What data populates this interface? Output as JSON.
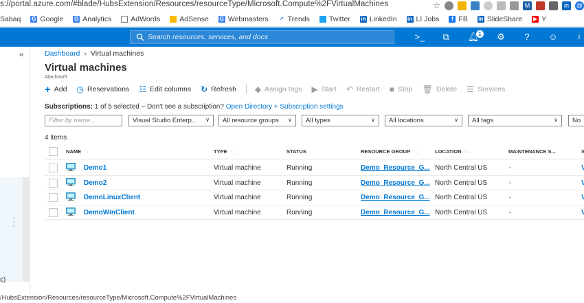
{
  "browser": {
    "url": "s://portal.azure.com/#blade/HubsExtension/Resources/resourceType/Microsoft.Compute%2FVirtualMachines",
    "bookmarks": [
      "Sabaq",
      "Google",
      "Analytics",
      "AdWords",
      "AdSense",
      "Webmasters",
      "Trends",
      "Twitter",
      "LinkedIn",
      "LI Jobs",
      "FB",
      "SlideShare",
      "Y"
    ],
    "status_url": "/HubsExtension/Resources/resourceType/Microsoft.Compute%2FVirtualMachines"
  },
  "topbar": {
    "search_placeholder": "Search resources, services, and docs",
    "notification_count": "1",
    "user_initial": "i"
  },
  "leftnav": {
    "collapse_label": "«",
    "fragment": "c)"
  },
  "breadcrumb": {
    "home": "Dashboard",
    "current": "Virtual machines"
  },
  "page": {
    "title": "Virtual machines",
    "subtitle": "Alachisoft"
  },
  "commands": {
    "add": "Add",
    "reservations": "Reservations",
    "edit_columns": "Edit columns",
    "refresh": "Refresh",
    "assign_tags": "Assign tags",
    "start": "Start",
    "restart": "Restart",
    "stop": "Stop",
    "delete": "Delete",
    "services": "Services"
  },
  "subscriptions": {
    "label": "Subscriptions:",
    "text": " 1 of 5 selected – Don't see a subscription? ",
    "link": "Open Directory + Subscription settings"
  },
  "filters": {
    "name_placeholder": "Filter by name...",
    "subscription": "Visual Studio Enterp...",
    "resource_groups": "All resource groups",
    "types": "All types",
    "locations": "All locations",
    "tags": "All tags",
    "extra": "No"
  },
  "item_count": "4 items",
  "table": {
    "columns": {
      "name": "NAME",
      "type": "TYPE",
      "status": "STATUS",
      "resource_group": "RESOURCE GROUP",
      "location": "LOCATION",
      "maintenance": "MAINTENANCE S...",
      "extra": "S"
    },
    "rows": [
      {
        "name": "Demo1",
        "type": "Virtual machine",
        "status": "Running",
        "resource_group": "Demo_Resource_G...",
        "location": "North Central US",
        "maintenance": "-",
        "extra": "V"
      },
      {
        "name": "Demo2",
        "type": "Virtual machine",
        "status": "Running",
        "resource_group": "Demo_Resource_G...",
        "location": "North Central US",
        "maintenance": "-",
        "extra": "V"
      },
      {
        "name": "DemoLinuxClient",
        "type": "Virtual machine",
        "status": "Running",
        "resource_group": "Demo_Resource_G...",
        "location": "North Central US",
        "maintenance": "-",
        "extra": "V"
      },
      {
        "name": "DemoWinClient",
        "type": "Virtual machine",
        "status": "Running",
        "resource_group": "Demo_Resource_G...",
        "location": "North Central US",
        "maintenance": "-",
        "extra": "V"
      }
    ]
  },
  "colors": {
    "azure_blue": "#0078d4",
    "text": "#323130",
    "disabled": "#a19f9d"
  }
}
